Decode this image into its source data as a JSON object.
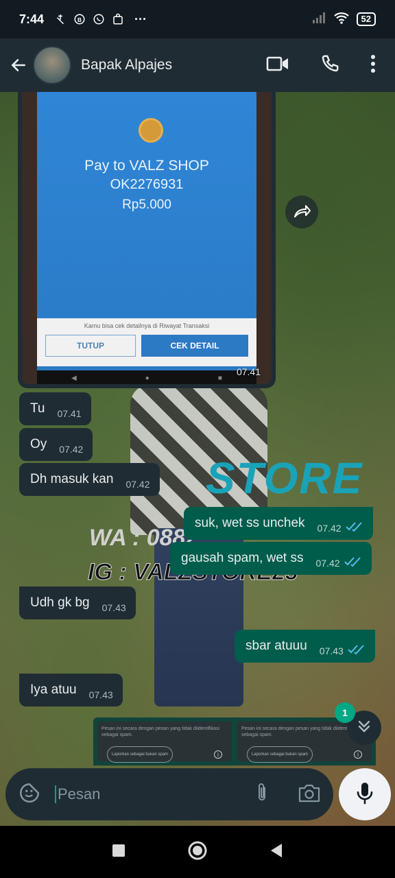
{
  "status_bar": {
    "time": "7:44",
    "more": "···",
    "battery": "52"
  },
  "header": {
    "contact_name": "Bapak Alpajes"
  },
  "image_message": {
    "pay_title": "Pay to VALZ SHOP",
    "pay_code": "OK2276931",
    "pay_amount": "Rp5.000",
    "note": "Kamu bisa cek detailnya di Riwayat Transaksi",
    "btn_close": "TUTUP",
    "btn_detail": "CEK DETAIL",
    "time": "07.41"
  },
  "watermark": {
    "store": "STORE",
    "wa": "WA : 0882",
    "ig": "IG : VALZSTORE23"
  },
  "messages": [
    {
      "text": "Tu",
      "time": "07.41",
      "dir": "in"
    },
    {
      "text": "Oy",
      "time": "07.42",
      "dir": "in"
    },
    {
      "text": "Dh masuk kan",
      "time": "07.42",
      "dir": "in"
    },
    {
      "text": "suk, wet ss unchek",
      "time": "07.42",
      "dir": "out"
    },
    {
      "text": "gausah spam, wet ss",
      "time": "07.42",
      "dir": "out"
    },
    {
      "text": "Udh gk bg",
      "time": "07.43",
      "dir": "in"
    },
    {
      "text": "sbar atuuu",
      "time": "07.43",
      "dir": "out"
    },
    {
      "text": "Iya atuu",
      "time": "07.43",
      "dir": "in"
    }
  ],
  "report_cards": [
    {
      "text": "Pesan ini secara dengan pesan yang tidak diidentifikasi sebagai spam.",
      "button": "Laporkan sebagai bukan spam"
    },
    {
      "text": "Pesan ini secara dengan pesan yang tidak diidentifikasi sebagai spam.",
      "button": "Laporkan sebagai bukan spam"
    }
  ],
  "unread_count": "1",
  "input": {
    "placeholder": "Pesan"
  },
  "colors": {
    "incoming_bubble": "#1f2c34",
    "outgoing_bubble": "#005c4b",
    "accent": "#00a884",
    "read_ticks": "#53bdeb"
  }
}
